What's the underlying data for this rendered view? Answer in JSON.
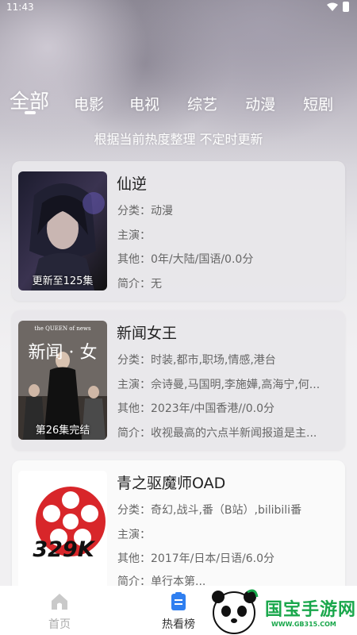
{
  "status_bar": {
    "time": "11:43"
  },
  "tabs": [
    "全部",
    "电影",
    "电视",
    "综艺",
    "动漫",
    "短剧"
  ],
  "subtitle": "根据当前热度整理 不定时更新",
  "cards": [
    {
      "title": "仙逆",
      "poster_caption": "更新至125集",
      "category": "分类：动漫",
      "cast": "主演：",
      "other": "其他：0年/大陆/国语/0.0分",
      "intro": "简介：无"
    },
    {
      "title": "新闻女王",
      "poster_caption": "第26集完结",
      "poster_text_top": "the QUEEN of news",
      "poster_text_mid": "新闻 · 女",
      "category": "分类：时装,都市,职场,情感,港台",
      "cast": "主演：佘诗曼,马国明,李施嬅,高海宁,何...",
      "other": "其他：2023年/中国香港//0.0分",
      "intro": "简介：收视最高的六点半新闻报道是主..."
    },
    {
      "title": "青之驱魔师OAD",
      "poster_logo": "329K",
      "category": "分类：奇幻,战斗,番（B站）,bilibili番",
      "cast": "主演：",
      "other": "其他：2017年/日本/日语/6.0分",
      "intro": "简介：单行本第..."
    }
  ],
  "bottom_nav": [
    {
      "label": "首页",
      "icon": "home-icon"
    },
    {
      "label": "热看榜",
      "icon": "list-icon"
    }
  ],
  "watermark": {
    "text": "国宝手游网",
    "url": "WWW.GB315.COM"
  },
  "colors": {
    "accent_blue": "#2f7ff0",
    "watermark_green": "#19a74b"
  }
}
